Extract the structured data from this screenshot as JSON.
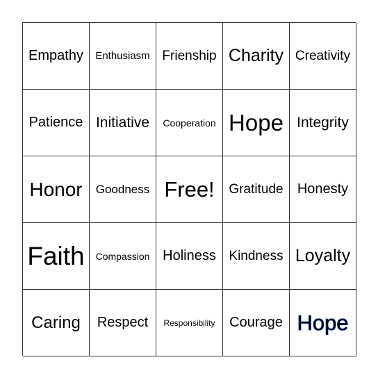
{
  "cells": [
    "Empathy",
    "Enthusiasm",
    "Frienship",
    "Charity",
    "Creativity",
    "Patience",
    "Initiative",
    "Cooperation",
    "Hope",
    "Integrity",
    "Honor",
    "Goodness",
    "Free!",
    "Gratitude",
    "Honesty",
    "Faith",
    "Compassion",
    "Holiness",
    "Kindness",
    "Loyalty",
    "Caring",
    "Respect",
    "Responsibility",
    "Courage",
    "Hope"
  ],
  "highlight_color": "#2b55e0"
}
